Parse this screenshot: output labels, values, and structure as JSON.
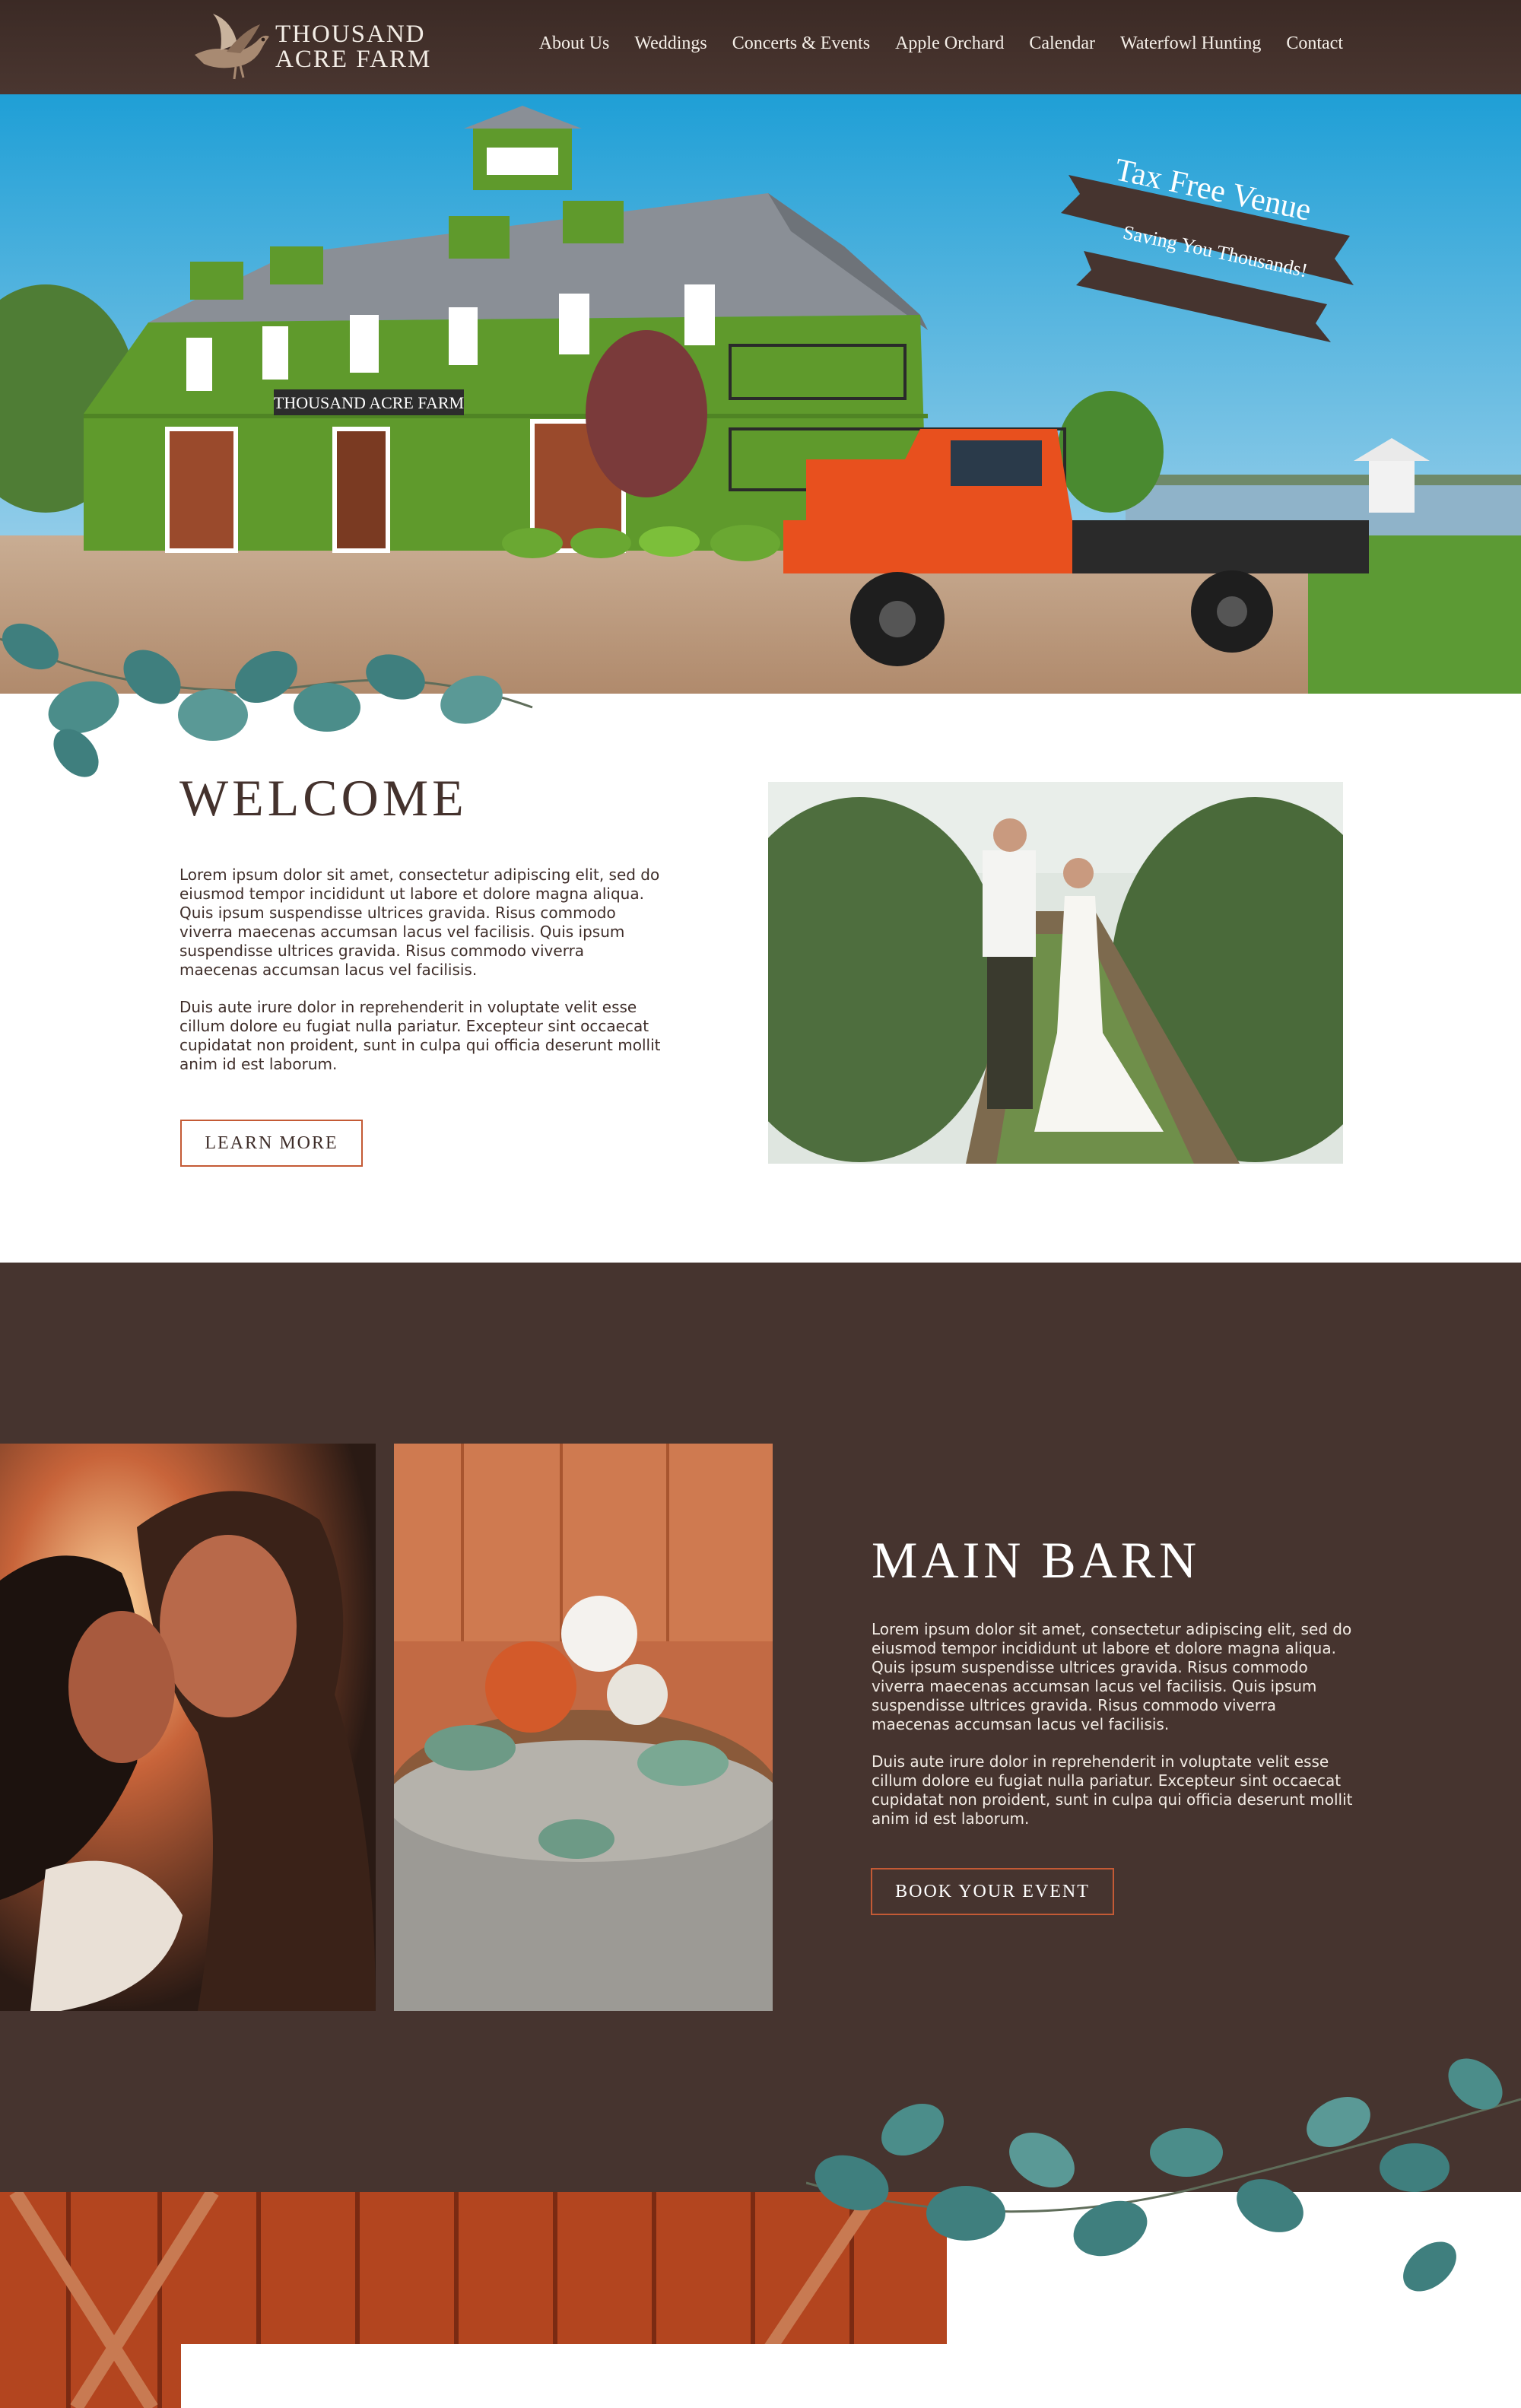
{
  "header": {
    "logo_line1": "THOUSAND",
    "logo_line2": "ACRE FARM",
    "nav": [
      {
        "label": "About Us"
      },
      {
        "label": "Weddings"
      },
      {
        "label": "Concerts & Events"
      },
      {
        "label": "Apple Orchard"
      },
      {
        "label": "Calendar"
      },
      {
        "label": "Waterfowl Hunting"
      },
      {
        "label": "Contact"
      }
    ]
  },
  "hero": {
    "barn_sign": "THOUSAND ACRE FARM",
    "ribbon_top": "Tax Free Venue",
    "ribbon_bottom": "Saving You Thousands!"
  },
  "welcome": {
    "title": "WELCOME",
    "paragraph1": "Lorem ipsum dolor sit amet, consectetur adipiscing elit, sed do eiusmod tempor incididunt ut labore et dolore magna aliqua. Quis ipsum suspendisse ultrices gravida. Risus commodo viverra maecenas accumsan lacus vel facilisis. Quis ipsum suspendisse ultrices gravida. Risus commodo viverra maecenas accumsan lacus vel facilisis.",
    "paragraph2": "Duis aute irure dolor in reprehenderit in voluptate velit esse cillum dolore eu fugiat nulla pariatur. Excepteur sint occaecat cupidatat non proident, sunt in culpa qui officia deserunt mollit anim id est laborum.",
    "button": "LEARN MORE"
  },
  "main_barn": {
    "title": "MAIN BARN",
    "paragraph1": "Lorem ipsum dolor sit amet, consectetur adipiscing elit, sed do eiusmod tempor incididunt ut labore et dolore magna aliqua. Quis ipsum suspendisse ultrices gravida. Risus commodo viverra maecenas accumsan lacus vel facilisis. Quis ipsum suspendisse ultrices gravida. Risus commodo viverra maecenas accumsan lacus vel facilisis.",
    "paragraph2": "Duis aute irure dolor in reprehenderit in voluptate velit esse cillum dolore eu fugiat nulla pariatur. Excepteur sint occaecat cupidatat non proident, sunt in culpa qui officia deserunt mollit anim id est laborum.",
    "button": "BOOK YOUR EVENT"
  },
  "colors": {
    "header_bg": "#43312c",
    "section_brown": "#46342f",
    "button_border": "#c45a35",
    "barn_green": "#5f9a2c",
    "truck_orange": "#e8501e",
    "leaf_teal": "#3f7f7e"
  }
}
